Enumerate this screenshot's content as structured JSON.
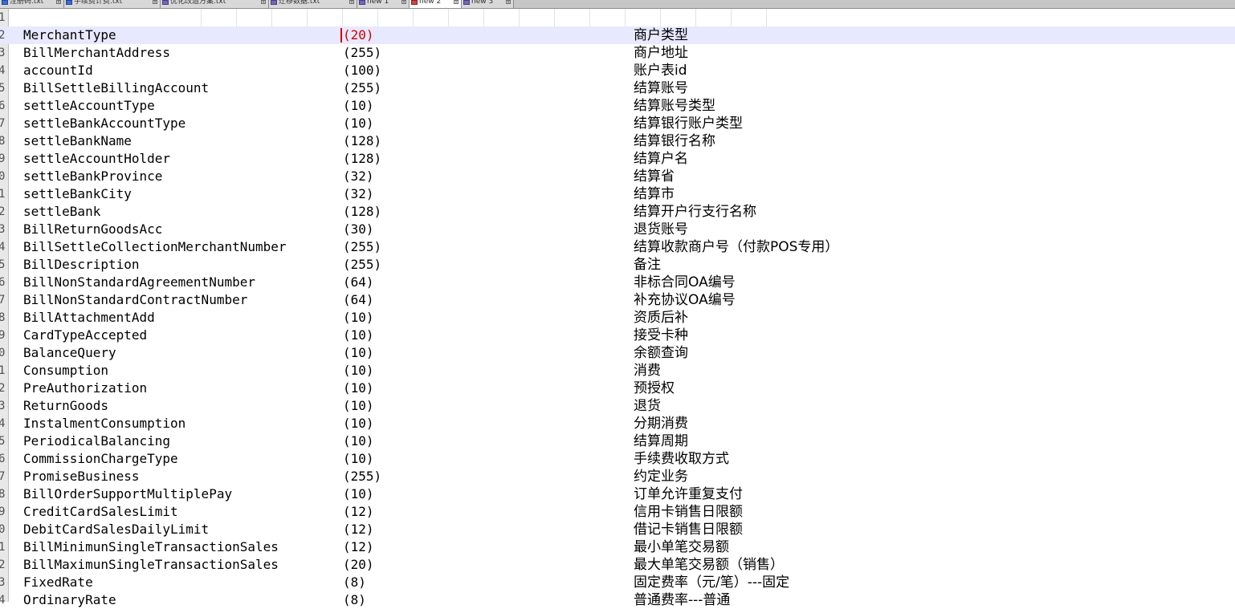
{
  "tabs": [
    {
      "label": "注册码.txt",
      "icon": "file-blue-icon",
      "active": false
    },
    {
      "label": "手续费计费.txt",
      "icon": "file-blue-icon",
      "active": false
    },
    {
      "label": "优化改造方案.txt",
      "icon": "file-purple-icon",
      "active": false
    },
    {
      "label": "迁移数据.txt",
      "icon": "file-purple-icon",
      "active": false
    },
    {
      "label": "new 1",
      "icon": "file-purple-icon",
      "active": false
    },
    {
      "label": "new 2",
      "icon": "file-red-icon",
      "active": true
    },
    {
      "label": "new 3",
      "icon": "file-purple-icon",
      "active": false
    }
  ],
  "editor": {
    "current_line": 2,
    "lines": [
      {
        "num": "1",
        "field": "",
        "size": "",
        "desc": ""
      },
      {
        "num": "2",
        "field": "MerchantType",
        "size": "(20)",
        "desc": "商户类型"
      },
      {
        "num": "3",
        "field": "BillMerchantAddress",
        "size": "(255)",
        "desc": "商户地址"
      },
      {
        "num": "4",
        "field": "accountId",
        "size": "(100)",
        "desc": "账户表id"
      },
      {
        "num": "5",
        "field": "BillSettleBillingAccount",
        "size": "(255)",
        "desc": "结算账号"
      },
      {
        "num": "6",
        "field": "settleAccountType",
        "size": "(10)",
        "desc": "结算账号类型"
      },
      {
        "num": "7",
        "field": "settleBankAccountType",
        "size": "(10)",
        "desc": "结算银行账户类型"
      },
      {
        "num": "8",
        "field": "settleBankName",
        "size": "(128)",
        "desc": "结算银行名称"
      },
      {
        "num": "9",
        "field": "settleAccountHolder",
        "size": "(128)",
        "desc": "结算户名"
      },
      {
        "num": "0",
        "field": "settleBankProvince",
        "size": "(32)",
        "desc": "结算省"
      },
      {
        "num": "1",
        "field": "settleBankCity",
        "size": "(32)",
        "desc": "结算市"
      },
      {
        "num": "2",
        "field": "settleBank",
        "size": "(128)",
        "desc": "结算开户行支行名称"
      },
      {
        "num": "3",
        "field": "BillReturnGoodsAcc",
        "size": "(30)",
        "desc": "退货账号"
      },
      {
        "num": "4",
        "field": "BillSettleCollectionMerchantNumber",
        "size": "(255)",
        "desc": "结算收款商户号（付款POS专用）"
      },
      {
        "num": "5",
        "field": "BillDescription",
        "size": "(255)",
        "desc": "备注"
      },
      {
        "num": "6",
        "field": "BillNonStandardAgreementNumber",
        "size": "(64)",
        "desc": "非标合同OA编号"
      },
      {
        "num": "7",
        "field": "BillNonStandardContractNumber",
        "size": "(64)",
        "desc": "补充协议OA编号"
      },
      {
        "num": "8",
        "field": "BillAttachmentAdd",
        "size": "(10)",
        "desc": "资质后补"
      },
      {
        "num": "9",
        "field": "CardTypeAccepted",
        "size": "(10)",
        "desc": "接受卡种"
      },
      {
        "num": "0",
        "field": "BalanceQuery",
        "size": "(10)",
        "desc": "余额查询"
      },
      {
        "num": "1",
        "field": "Consumption",
        "size": "(10)",
        "desc": "消费"
      },
      {
        "num": "2",
        "field": "PreAuthorization",
        "size": "(10)",
        "desc": "预授权"
      },
      {
        "num": "3",
        "field": "ReturnGoods",
        "size": "(10)",
        "desc": "退货"
      },
      {
        "num": "4",
        "field": "InstalmentConsumption",
        "size": "(10)",
        "desc": "分期消费"
      },
      {
        "num": "5",
        "field": "PeriodicalBalancing",
        "size": "(10)",
        "desc": "结算周期"
      },
      {
        "num": "6",
        "field": "CommissionChargeType",
        "size": "(10)",
        "desc": "手续费收取方式"
      },
      {
        "num": "7",
        "field": "PromiseBusiness",
        "size": "(255)",
        "desc": "约定业务"
      },
      {
        "num": "8",
        "field": "BillOrderSupportMultiplePay",
        "size": "(10)",
        "desc": "订单允许重复支付"
      },
      {
        "num": "9",
        "field": "CreditCardSalesLimit",
        "size": "(12)",
        "desc": "信用卡销售日限额"
      },
      {
        "num": "0",
        "field": "DebitCardSalesDailyLimit",
        "size": "(12)",
        "desc": "借记卡销售日限额"
      },
      {
        "num": "1",
        "field": "BillMinimunSingleTransactionSales",
        "size": "(12)",
        "desc": "最小单笔交易额"
      },
      {
        "num": "2",
        "field": "BillMaximunSingleTransactionSales",
        "size": "(20)",
        "desc": "最大单笔交易额（销售）"
      },
      {
        "num": "3",
        "field": "FixedRate",
        "size": "(8)",
        "desc": "固定费率（元/笔）---固定"
      },
      {
        "num": "4",
        "field": "OrdinaryRate",
        "size": "(8)",
        "desc": "普通费率---普通"
      }
    ]
  }
}
